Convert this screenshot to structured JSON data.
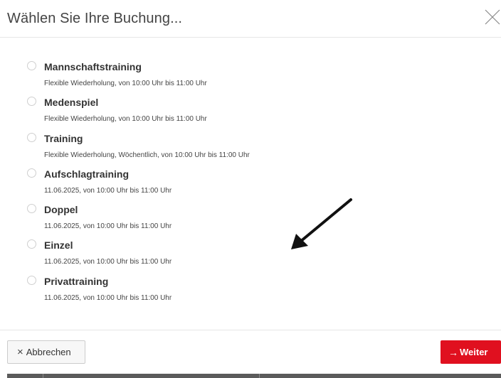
{
  "dialog": {
    "title": "Wählen Sie Ihre Buchung..."
  },
  "options": [
    {
      "title": "Mannschaftstraining",
      "subtitle": "Flexible Wiederholung, von 10:00 Uhr bis 11:00 Uhr"
    },
    {
      "title": "Medenspiel",
      "subtitle": "Flexible Wiederholung, von 10:00 Uhr bis 11:00 Uhr"
    },
    {
      "title": "Training",
      "subtitle": "Flexible Wiederholung, Wöchentlich, von 10:00 Uhr bis 11:00 Uhr"
    },
    {
      "title": "Aufschlagtraining",
      "subtitle": "11.06.2025, von 10:00 Uhr bis 11:00 Uhr"
    },
    {
      "title": "Doppel",
      "subtitle": "11.06.2025, von 10:00 Uhr bis 11:00 Uhr"
    },
    {
      "title": "Einzel",
      "subtitle": "11.06.2025, von 10:00 Uhr bis 11:00 Uhr"
    },
    {
      "title": "Privattraining",
      "subtitle": "11.06.2025, von 10:00 Uhr bis 11:00 Uhr"
    }
  ],
  "footer": {
    "cancel_label": "Abbrechen",
    "next_label": "Weiter"
  },
  "icons": {
    "close": "close-icon",
    "cancel": "x-icon",
    "next": "arrow-right-icon",
    "annotation": "arrow-annotation-icon"
  },
  "colors": {
    "primary": "#e0101f",
    "text": "#333333",
    "divider": "#e6e6e6"
  }
}
